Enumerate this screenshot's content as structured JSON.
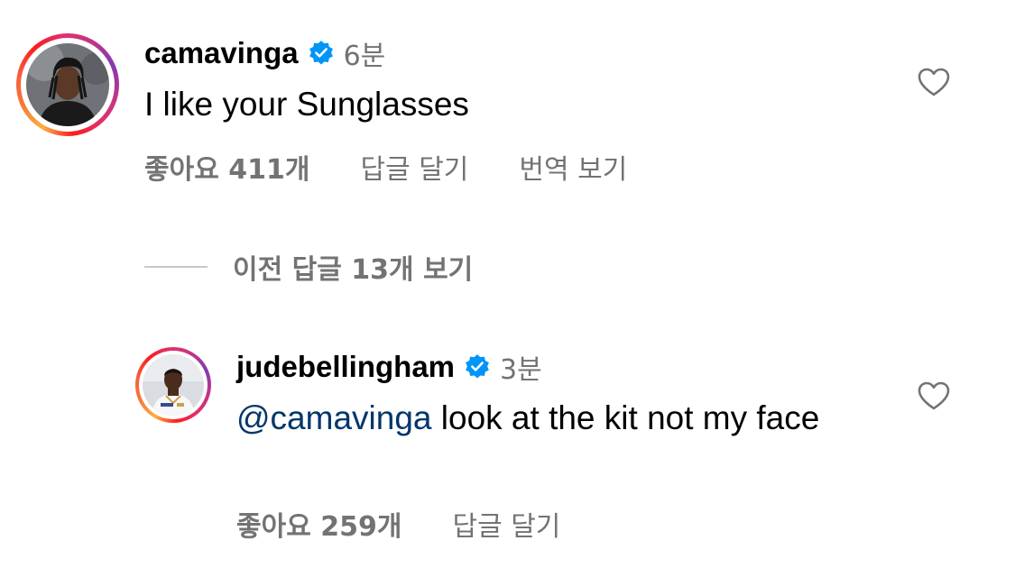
{
  "comments": [
    {
      "username": "camavinga",
      "verified": true,
      "time": "6분",
      "text": "I like your Sunglasses",
      "likes": "좋아요 411개",
      "reply_label": "답글 달기",
      "translate_label": "번역 보기"
    },
    {
      "username": "judebellingham",
      "verified": true,
      "time": "3분",
      "mention": "@camavinga",
      "text_after_mention": " look at the kit not my face",
      "likes": "좋아요 259개",
      "reply_label": "답글 달기"
    }
  ],
  "view_previous_replies": "이전 답글 13개 보기",
  "icons": {
    "verified": "verified-badge-icon",
    "like": "heart-outline-icon"
  },
  "colors": {
    "text": "#000000",
    "secondary": "#737373",
    "mention": "#00376b",
    "verified": "#0095f6",
    "divider": "#c7c7c7"
  }
}
